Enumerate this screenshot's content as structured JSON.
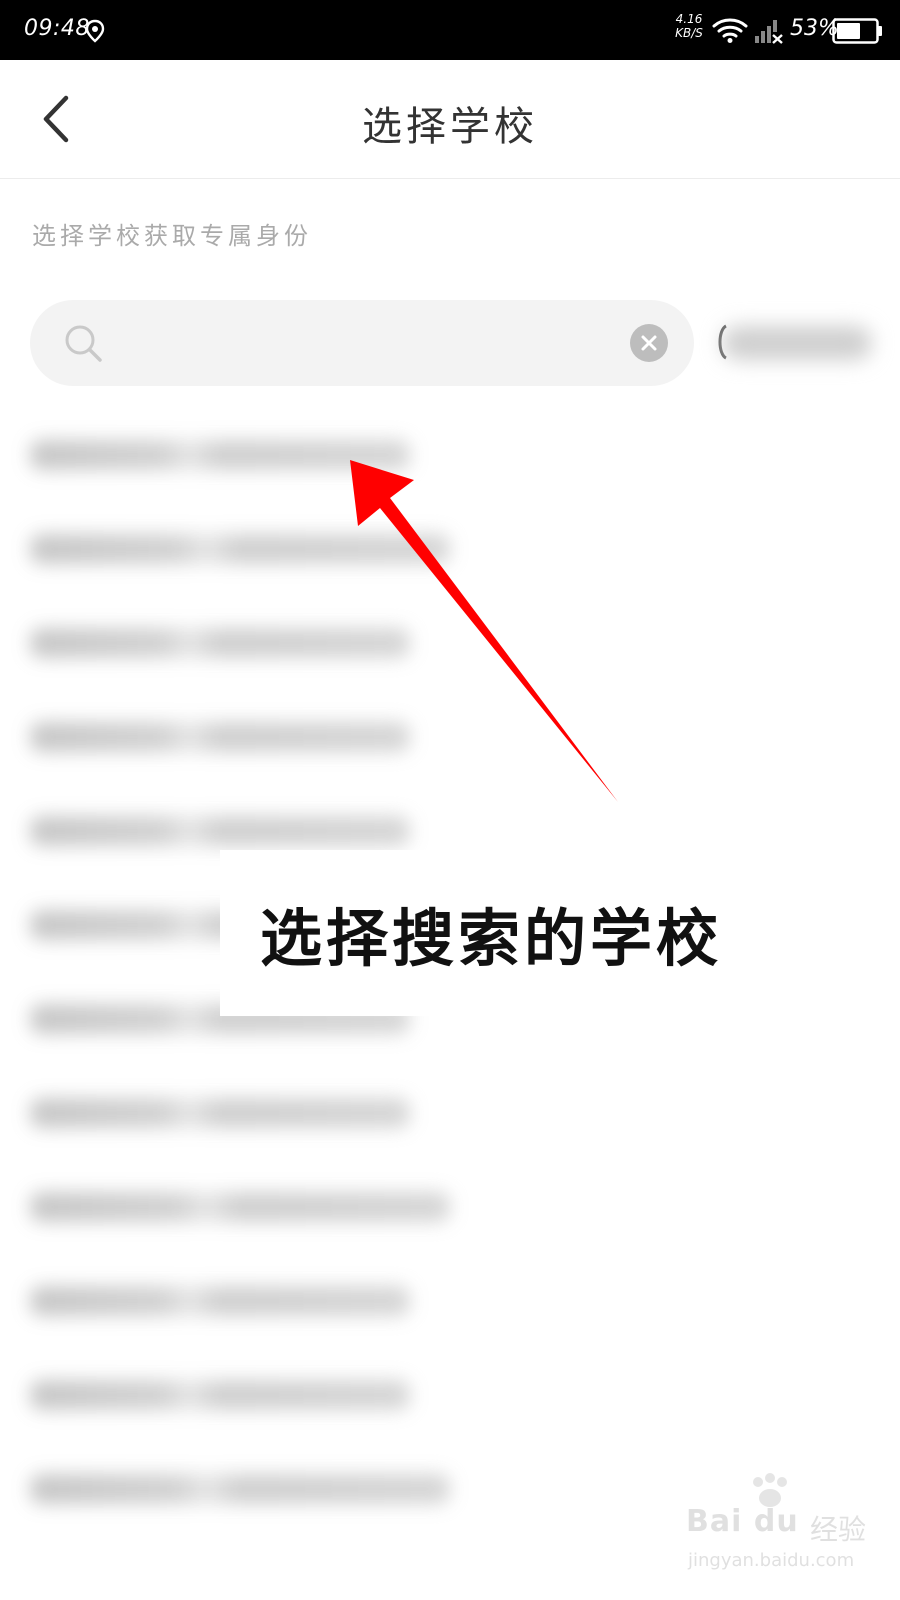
{
  "status_bar": {
    "time": "09:48",
    "net_speed_value": "4.16",
    "net_speed_unit": "KB/S",
    "battery_percent": "53%"
  },
  "header": {
    "title": "选择学校"
  },
  "subtitle": "选择学校获取专属身份",
  "search": {
    "query": "",
    "icons": {
      "search": "search-icon",
      "clear": "clear-icon"
    }
  },
  "results_count_visible": 12,
  "annotation": {
    "text": "选择搜索的学校",
    "arrow_color": "#ff0000"
  },
  "watermark": {
    "brand": "Bai du",
    "brand_sub": "经验",
    "url": "jingyan.baidu.com"
  },
  "colors": {
    "status_bar_bg": "#000000",
    "search_bg": "#f3f3f3",
    "subtitle": "#aaaaaa",
    "title": "#333333"
  }
}
